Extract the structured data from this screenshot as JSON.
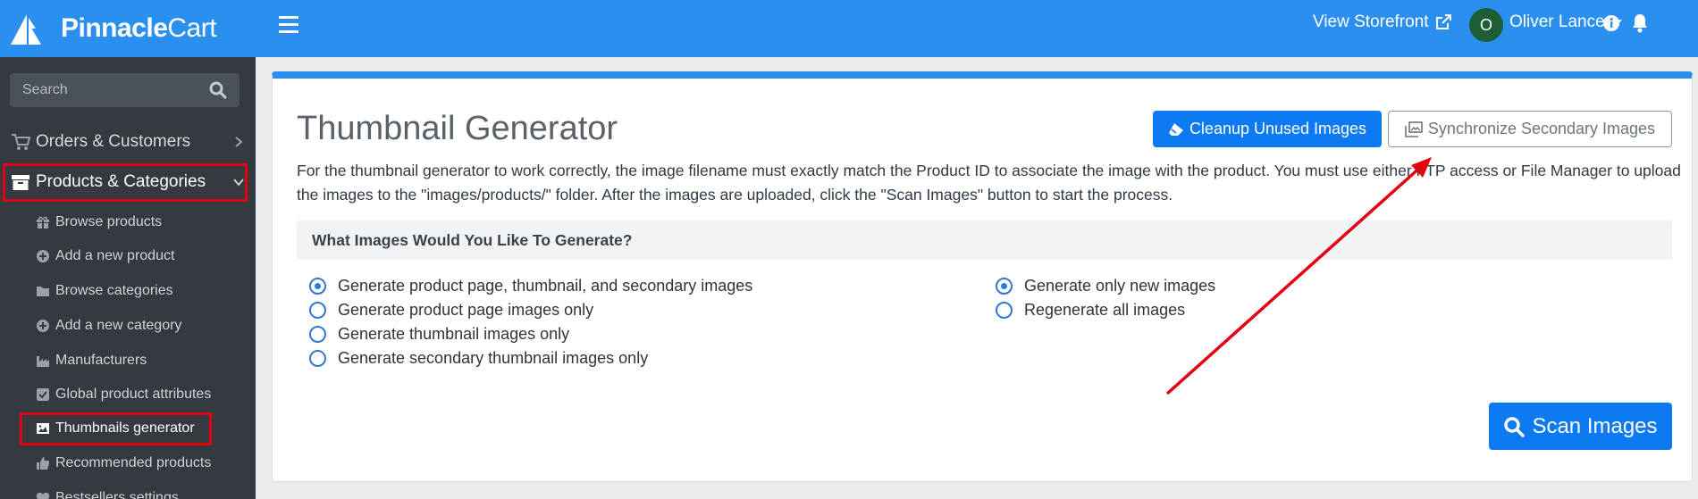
{
  "brand": {
    "name_bold": "Pinnacle",
    "name_light": "Cart"
  },
  "search": {
    "placeholder": "Search"
  },
  "nav": {
    "orders": "Orders & Customers",
    "products": "Products & Categories",
    "sub_items": [
      {
        "label": "Browse products",
        "icon": "gift-icon"
      },
      {
        "label": "Add a new product",
        "icon": "plus-circle-icon"
      },
      {
        "label": "Browse categories",
        "icon": "folder-icon"
      },
      {
        "label": "Add a new category",
        "icon": "plus-circle-icon"
      },
      {
        "label": "Manufacturers",
        "icon": "industry-icon"
      },
      {
        "label": "Global product attributes",
        "icon": "check-square-icon"
      },
      {
        "label": "Thumbnails generator",
        "icon": "image-icon"
      },
      {
        "label": "Recommended products",
        "icon": "thumbs-up-icon"
      },
      {
        "label": "Bestsellers settings",
        "icon": "heart-icon"
      }
    ]
  },
  "topbar": {
    "storefront": "View Storefront",
    "avatar_initial": "O",
    "user_name": "Oliver Lance"
  },
  "main": {
    "title": "Thumbnail Generator",
    "cleanup_button": "Cleanup Unused Images",
    "sync_button": "Synchronize Secondary Images",
    "description": "For the thumbnail generator to work correctly, the image filename must exactly match the Product ID to associate the image with the product. You must use either FTP access or File Manager to upload the images to the \"images/products/\" folder. After the images are uploaded, click the \"Scan Images\" button to start the process.",
    "section_title": "What Images Would You Like To Generate?",
    "type_options": [
      {
        "label": "Generate product page, thumbnail, and secondary images",
        "checked": true
      },
      {
        "label": "Generate product page images only",
        "checked": false
      },
      {
        "label": "Generate thumbnail images only",
        "checked": false
      },
      {
        "label": "Generate secondary thumbnail images only",
        "checked": false
      }
    ],
    "mode_options": [
      {
        "label": "Generate only new images",
        "checked": true
      },
      {
        "label": "Regenerate all images",
        "checked": false
      }
    ],
    "scan_button": "Scan Images"
  },
  "colors": {
    "primary": "#2b8fef",
    "button": "#0d79f2",
    "sidebar": "#343a40",
    "highlight": "#e3000f"
  }
}
